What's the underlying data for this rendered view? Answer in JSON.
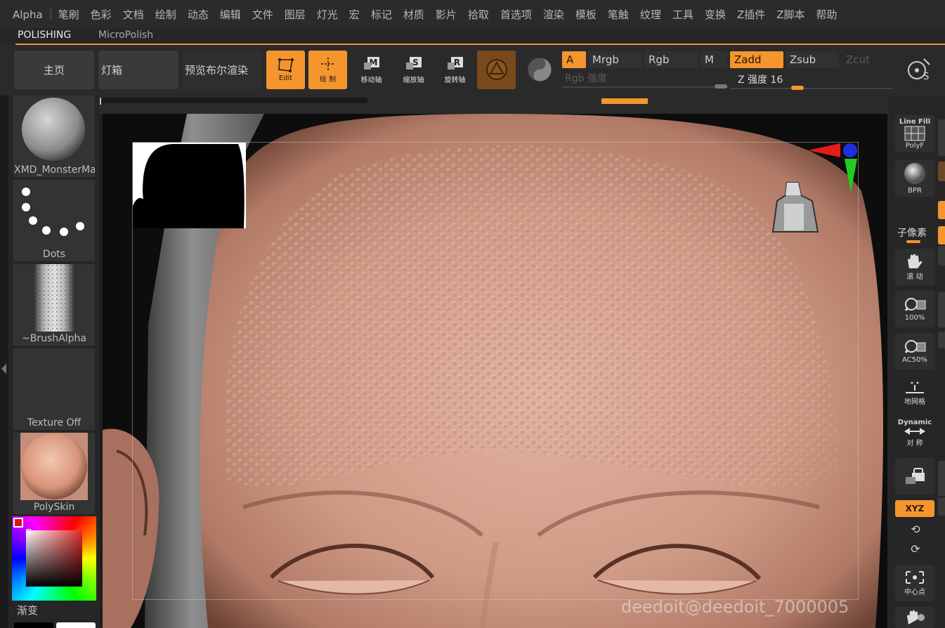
{
  "menu": [
    "Alpha",
    "笔刷",
    "色彩",
    "文档",
    "绘制",
    "动态",
    "编辑",
    "文件",
    "图层",
    "灯光",
    "宏",
    "标记",
    "材质",
    "影片",
    "拾取",
    "首选项",
    "渲染",
    "模板",
    "笔触",
    "纹理",
    "工具",
    "变换",
    "Z插件",
    "Z脚本",
    "帮助"
  ],
  "palette_tabs": {
    "active": "POLISHING",
    "other": "MicroPolish"
  },
  "shelf": {
    "home": "主页",
    "lightbox": "灯箱",
    "preview_boolean": "预览布尔渲染",
    "edit": "Edit",
    "draw": "绘 制",
    "move": "移动轴",
    "scale": "缩放轴",
    "rotate": "旋转轴"
  },
  "channels": {
    "a": "A",
    "mrgb": "Mrgb",
    "rgb": "Rgb",
    "m": "M",
    "zadd": "Zadd",
    "zsub": "Zsub",
    "zcut": "Zcut",
    "rgb_intensity_label": "Rgb 强度",
    "z_intensity_label": "Z 强度 16",
    "z_intensity": 16
  },
  "left_tray": {
    "brush_name": "XMD_MonsterMa",
    "stroke_name": "Dots",
    "alpha_name": "~BrushAlpha",
    "texture_name": "Texture Off",
    "material_name": "PolySkin",
    "gradient_label": "渐变"
  },
  "right_tray": {
    "linefill_top": "Line Fill",
    "linefill_sub": "PolyF",
    "bpr": "BPR",
    "subpixel": "子像素",
    "scroll": "滚 动",
    "zoom100": "100%",
    "ac50": "AC50%",
    "floor": "地网格",
    "dynamic": "Dynamic",
    "symmetry": "对 称",
    "xyz": "XYZ",
    "center": "中心点"
  },
  "watermark": "deedoit@deedoit_7000005",
  "colors": {
    "accent": "#f5952e",
    "skin": "#c99580"
  }
}
